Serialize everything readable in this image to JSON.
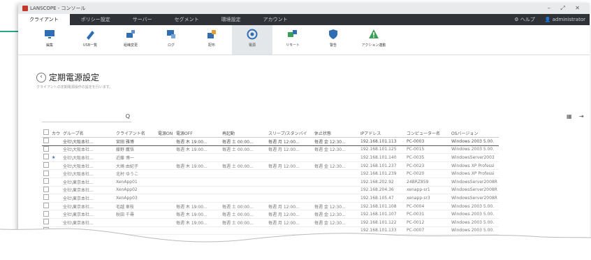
{
  "window": {
    "title": "LANSCOPE - コンソール",
    "controls": "– ⤢ ✕"
  },
  "menu": {
    "items": [
      "クライアント",
      "ポリシー設定",
      "サーバー",
      "セグメント",
      "環境設定",
      "アカウント"
    ],
    "help": "⚙ ヘルプ",
    "user": "👤 administrator"
  },
  "toolbar": {
    "items": [
      {
        "label": "編集",
        "icon": "monitor-icon",
        "color": "#2f6db5"
      },
      {
        "label": "USB一覧",
        "icon": "usb-icon",
        "color": "#2f6db5"
      },
      {
        "label": "組織変更",
        "icon": "org-icon",
        "color": "#2f6db5"
      },
      {
        "label": "ログ",
        "icon": "log-icon",
        "color": "#2f6db5"
      },
      {
        "label": "配布",
        "icon": "deploy-icon",
        "color": "#e6a029"
      },
      {
        "label": "電源",
        "icon": "power-icon",
        "color": "#2f6db5"
      },
      {
        "label": "リモート",
        "icon": "remote-icon",
        "color": "#3aa055"
      },
      {
        "label": "警告",
        "icon": "shield-icon",
        "color": "#2f6db5"
      },
      {
        "label": "アクション連動",
        "icon": "warning-icon",
        "color": "#3aa055"
      }
    ],
    "active_index": 5
  },
  "page": {
    "title": "定期電源設定",
    "description": "クライアントの定期電源操作の設定を行います。",
    "back_glyph": "‹"
  },
  "search": {
    "glyph": "Q"
  },
  "table": {
    "columns": [
      "",
      "カウ",
      "グループ名",
      "クライアント名",
      "電源ON",
      "電源OFF",
      "再起動",
      "スリープ/スタンバイ",
      "休止状態",
      "IPアドレス",
      "コンピューター名",
      "OSバージョン"
    ],
    "rows": [
      [
        "",
        "",
        "全社\\大阪本社...",
        "宮田 雅博",
        "",
        "毎週 木 19:00...",
        "毎週 土 00:00...",
        "毎週 月 12:00...",
        "毎週 金 12:30...",
        "192.168.101.113",
        "PC-0003",
        "Windows 2003 5.00."
      ],
      [
        "",
        "",
        "全社\\大阪本社...",
        "藤野 鷹悟",
        "",
        "毎週 木 19:00...",
        "毎週 土 00:00...",
        "毎週 月 12:00...",
        "毎週 金 12:30...",
        "192.168.101.125",
        "PC-0015",
        "Windows 2003 5.00."
      ],
      [
        "",
        "★",
        "全社\\大阪本社...",
        "近藤 博一",
        "",
        "",
        "",
        "",
        "",
        "192.168.101.140",
        "PC-0035",
        "WindowsServer2003"
      ],
      [
        "",
        "",
        "全社\\大阪本社...",
        "大崎 由紀子",
        "",
        "毎週 木 19:00...",
        "毎週 土 00:00...",
        "毎週 月 12:00...",
        "毎週 金 12:30...",
        "192.168.101.237",
        "PC-0023",
        "Windows XP Professi"
      ],
      [
        "",
        "",
        "全社\\大阪本社...",
        "北村 ゆうこ",
        "",
        "",
        "",
        "",
        "",
        "192.168.101.239",
        "PC-0020",
        "Windows XP Professi"
      ],
      [
        "",
        "",
        "全社\\東京本社...",
        "XenApp01",
        "",
        "",
        "",
        "",
        "",
        "192.168.202.92",
        "24BRZ859",
        "WindowsServer2008R"
      ],
      [
        "",
        "",
        "全社\\東京本社...",
        "XenApp02",
        "",
        "",
        "",
        "",
        "",
        "192.168.204.36",
        "xenapp-sr1",
        "WindowsServer2008R"
      ],
      [
        "",
        "",
        "全社\\東京本社...",
        "XenApp03",
        "",
        "",
        "",
        "",
        "",
        "192.168.105.47",
        "xenapp-sr3",
        "WindowsServer2008R"
      ],
      [
        "",
        "",
        "全社\\東京本社...",
        "毛越 車枝",
        "",
        "毎週 木 19:00...",
        "毎週 土 00:00...",
        "毎週 月 12:00...",
        "毎週 金 12:30...",
        "192.168.101.108",
        "PC-0004",
        "Windows 2003 5.00."
      ],
      [
        "",
        "",
        "全社\\東京本社...",
        "秋田 千尋",
        "",
        "毎週 木 19:00...",
        "毎週 土 00:00...",
        "毎週 月 12:00...",
        "毎週 金 12:30...",
        "192.168.101.107",
        "PC-0031",
        "Windows 2003 5.00."
      ],
      [
        "",
        "",
        "全社\\東京本社...",
        "",
        "",
        "毎週 木 19:00...",
        "毎週 土 00:00...",
        "毎週 月 12:00...",
        "毎週 金 12:30...",
        "192.168.101.122",
        "PC-0012",
        "Windows 2003 5.00."
      ],
      [
        "",
        "",
        "",
        "",
        "",
        "",
        "",
        "",
        "",
        "192.168.101.133",
        "PC-0007",
        "Windows 2003 5.00."
      ]
    ],
    "selected_row": 0
  },
  "colors": {
    "accent": "#2aa58a",
    "menubar": "#2f3337"
  }
}
